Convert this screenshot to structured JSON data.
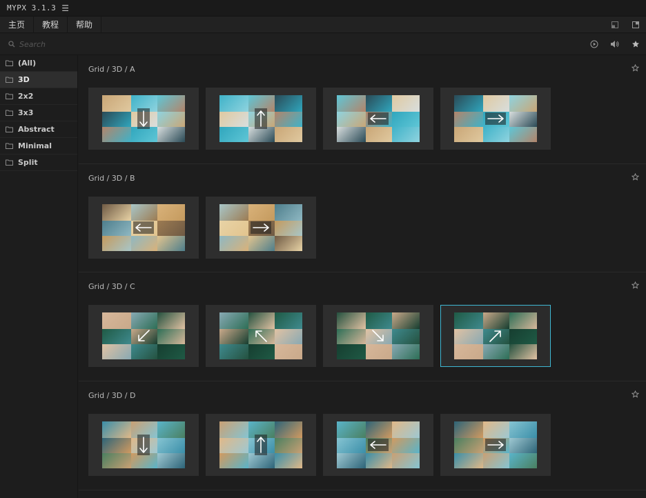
{
  "app": {
    "title": "MYPX 3.1.3"
  },
  "menu": {
    "items": [
      "主页",
      "教程",
      "帮助"
    ]
  },
  "search": {
    "placeholder": "Search"
  },
  "sidebar": {
    "items": [
      "(All)",
      "3D",
      "2x2",
      "3x3",
      "Abstract",
      "Minimal",
      "Split"
    ],
    "active_index": 1
  },
  "sections": [
    {
      "title": "Grid / 3D / A",
      "thumbs": [
        {
          "arrow": "down",
          "palette": "beach"
        },
        {
          "arrow": "up",
          "palette": "beach"
        },
        {
          "arrow": "left",
          "palette": "beach"
        },
        {
          "arrow": "right",
          "palette": "beach"
        }
      ]
    },
    {
      "title": "Grid / 3D / B",
      "thumbs": [
        {
          "arrow": "left",
          "palette": "desert"
        },
        {
          "arrow": "right",
          "palette": "desert"
        }
      ]
    },
    {
      "title": "Grid / 3D / C",
      "thumbs": [
        {
          "arrow": "down-left",
          "palette": "leaf"
        },
        {
          "arrow": "up-left",
          "palette": "leaf"
        },
        {
          "arrow": "down-right",
          "palette": "leaf"
        },
        {
          "arrow": "up-right",
          "palette": "leaf",
          "selected": true
        }
      ]
    },
    {
      "title": "Grid / 3D / D",
      "thumbs": [
        {
          "arrow": "down",
          "palette": "mosaic"
        },
        {
          "arrow": "up",
          "palette": "mosaic"
        },
        {
          "arrow": "left",
          "palette": "mosaic"
        },
        {
          "arrow": "right",
          "palette": "mosaic"
        }
      ]
    }
  ],
  "colors": {
    "accent": "#3fb8d4",
    "background": "#1d1d1d",
    "card": "#2e2e2e"
  },
  "icons": {
    "menu": "hamburger-icon",
    "search": "search-icon",
    "play": "play-icon",
    "volume": "volume-icon",
    "favorites": "star-icon",
    "section_favorite": "star-outline-icon",
    "folder": "folder-icon"
  }
}
